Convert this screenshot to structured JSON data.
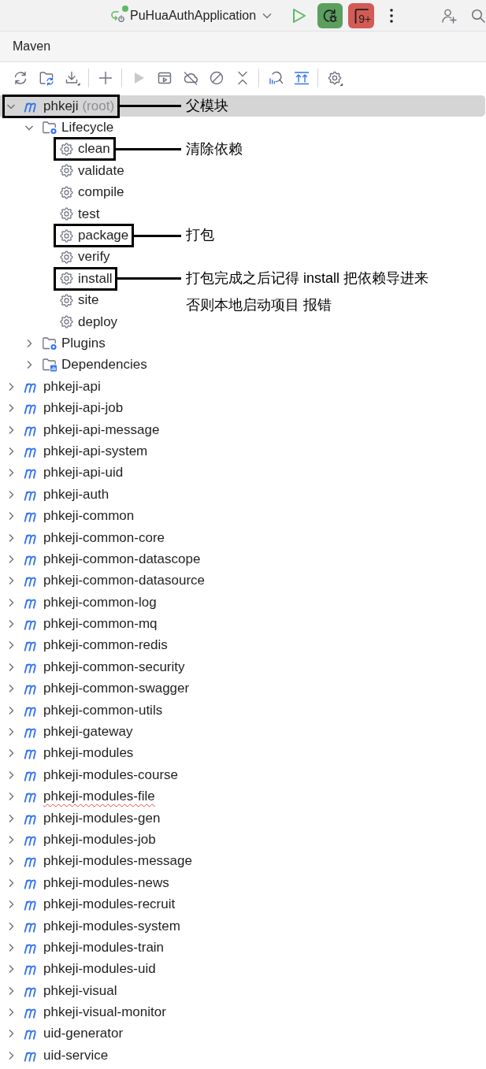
{
  "header": {
    "run_config": {
      "name": "PuHuaAuthApplication",
      "running": true
    },
    "counter": "9+"
  },
  "panel": {
    "title": "Maven"
  },
  "toolbar": [
    {
      "kind": "refresh",
      "disabled": false
    },
    {
      "kind": "reimport",
      "disabled": false
    },
    {
      "kind": "download",
      "disabled": false
    },
    {
      "kind": "separator"
    },
    {
      "kind": "add",
      "disabled": false
    },
    {
      "kind": "separator"
    },
    {
      "kind": "run",
      "disabled": true
    },
    {
      "kind": "run_config",
      "disabled": false
    },
    {
      "kind": "offline",
      "disabled": false
    },
    {
      "kind": "skip_tests",
      "disabled": false
    },
    {
      "kind": "collapse",
      "disabled": false
    },
    {
      "kind": "separator"
    },
    {
      "kind": "analyze",
      "disabled": false
    },
    {
      "kind": "show_deps",
      "disabled": false
    },
    {
      "kind": "separator"
    },
    {
      "kind": "settings",
      "disabled": false
    }
  ],
  "tree": [
    {
      "kind": "module",
      "label": "phkeji",
      "suffix": "(root)",
      "selected": true,
      "expanded": true,
      "spell_error": false,
      "note": [
        "父模块"
      ],
      "children": [
        {
          "kind": "lifecycle",
          "label": "Lifecycle",
          "selected": false,
          "expanded": true,
          "children": [
            {
              "kind": "goal",
              "label": "clean",
              "selected": false,
              "note": [
                "清除依赖"
              ]
            },
            {
              "kind": "goal",
              "label": "validate",
              "selected": false
            },
            {
              "kind": "goal",
              "label": "compile",
              "selected": false
            },
            {
              "kind": "goal",
              "label": "test",
              "selected": false
            },
            {
              "kind": "goal",
              "label": "package",
              "selected": false,
              "note": [
                "打包"
              ]
            },
            {
              "kind": "goal",
              "label": "verify",
              "selected": false
            },
            {
              "kind": "goal",
              "label": "install",
              "selected": false,
              "note": [
                "打包完成之后记得 install 把依赖导进来",
                "否则本地启动项目 报错"
              ]
            },
            {
              "kind": "goal",
              "label": "site",
              "selected": false
            },
            {
              "kind": "goal",
              "label": "deploy",
              "selected": false
            }
          ]
        },
        {
          "kind": "plugins",
          "label": "Plugins",
          "selected": false,
          "expanded": false
        },
        {
          "kind": "dependencies",
          "label": "Dependencies",
          "selected": false,
          "expanded": false
        }
      ]
    },
    {
      "kind": "module",
      "label": "phkeji-api",
      "selected": false,
      "expanded": false,
      "spell_error": false
    },
    {
      "kind": "module",
      "label": "phkeji-api-job",
      "selected": false,
      "expanded": false,
      "spell_error": false
    },
    {
      "kind": "module",
      "label": "phkeji-api-message",
      "selected": false,
      "expanded": false,
      "spell_error": false
    },
    {
      "kind": "module",
      "label": "phkeji-api-system",
      "selected": false,
      "expanded": false,
      "spell_error": false
    },
    {
      "kind": "module",
      "label": "phkeji-api-uid",
      "selected": false,
      "expanded": false,
      "spell_error": false
    },
    {
      "kind": "module",
      "label": "phkeji-auth",
      "selected": false,
      "expanded": false,
      "spell_error": false
    },
    {
      "kind": "module",
      "label": "phkeji-common",
      "selected": false,
      "expanded": false,
      "spell_error": false
    },
    {
      "kind": "module",
      "label": "phkeji-common-core",
      "selected": false,
      "expanded": false,
      "spell_error": false
    },
    {
      "kind": "module",
      "label": "phkeji-common-datascope",
      "selected": false,
      "expanded": false,
      "spell_error": false
    },
    {
      "kind": "module",
      "label": "phkeji-common-datasource",
      "selected": false,
      "expanded": false,
      "spell_error": false
    },
    {
      "kind": "module",
      "label": "phkeji-common-log",
      "selected": false,
      "expanded": false,
      "spell_error": false
    },
    {
      "kind": "module",
      "label": "phkeji-common-mq",
      "selected": false,
      "expanded": false,
      "spell_error": false
    },
    {
      "kind": "module",
      "label": "phkeji-common-redis",
      "selected": false,
      "expanded": false,
      "spell_error": false
    },
    {
      "kind": "module",
      "label": "phkeji-common-security",
      "selected": false,
      "expanded": false,
      "spell_error": false
    },
    {
      "kind": "module",
      "label": "phkeji-common-swagger",
      "selected": false,
      "expanded": false,
      "spell_error": false
    },
    {
      "kind": "module",
      "label": "phkeji-common-utils",
      "selected": false,
      "expanded": false,
      "spell_error": false
    },
    {
      "kind": "module",
      "label": "phkeji-gateway",
      "selected": false,
      "expanded": false,
      "spell_error": false
    },
    {
      "kind": "module",
      "label": "phkeji-modules",
      "selected": false,
      "expanded": false,
      "spell_error": false
    },
    {
      "kind": "module",
      "label": "phkeji-modules-course",
      "selected": false,
      "expanded": false,
      "spell_error": false
    },
    {
      "kind": "module",
      "label": "phkeji-modules-file",
      "selected": false,
      "expanded": false,
      "spell_error": true
    },
    {
      "kind": "module",
      "label": "phkeji-modules-gen",
      "selected": false,
      "expanded": false,
      "spell_error": false
    },
    {
      "kind": "module",
      "label": "phkeji-modules-job",
      "selected": false,
      "expanded": false,
      "spell_error": false
    },
    {
      "kind": "module",
      "label": "phkeji-modules-message",
      "selected": false,
      "expanded": false,
      "spell_error": false
    },
    {
      "kind": "module",
      "label": "phkeji-modules-news",
      "selected": false,
      "expanded": false,
      "spell_error": false
    },
    {
      "kind": "module",
      "label": "phkeji-modules-recruit",
      "selected": false,
      "expanded": false,
      "spell_error": false
    },
    {
      "kind": "module",
      "label": "phkeji-modules-system",
      "selected": false,
      "expanded": false,
      "spell_error": false
    },
    {
      "kind": "module",
      "label": "phkeji-modules-train",
      "selected": false,
      "expanded": false,
      "spell_error": false
    },
    {
      "kind": "module",
      "label": "phkeji-modules-uid",
      "selected": false,
      "expanded": false,
      "spell_error": false
    },
    {
      "kind": "module",
      "label": "phkeji-visual",
      "selected": false,
      "expanded": false,
      "spell_error": false
    },
    {
      "kind": "module",
      "label": "phkeji-visual-monitor",
      "selected": false,
      "expanded": false,
      "spell_error": false
    },
    {
      "kind": "module",
      "label": "uid-generator",
      "selected": false,
      "expanded": false,
      "spell_error": false
    },
    {
      "kind": "module",
      "label": "uid-service",
      "selected": false,
      "expanded": false,
      "spell_error": false
    }
  ]
}
